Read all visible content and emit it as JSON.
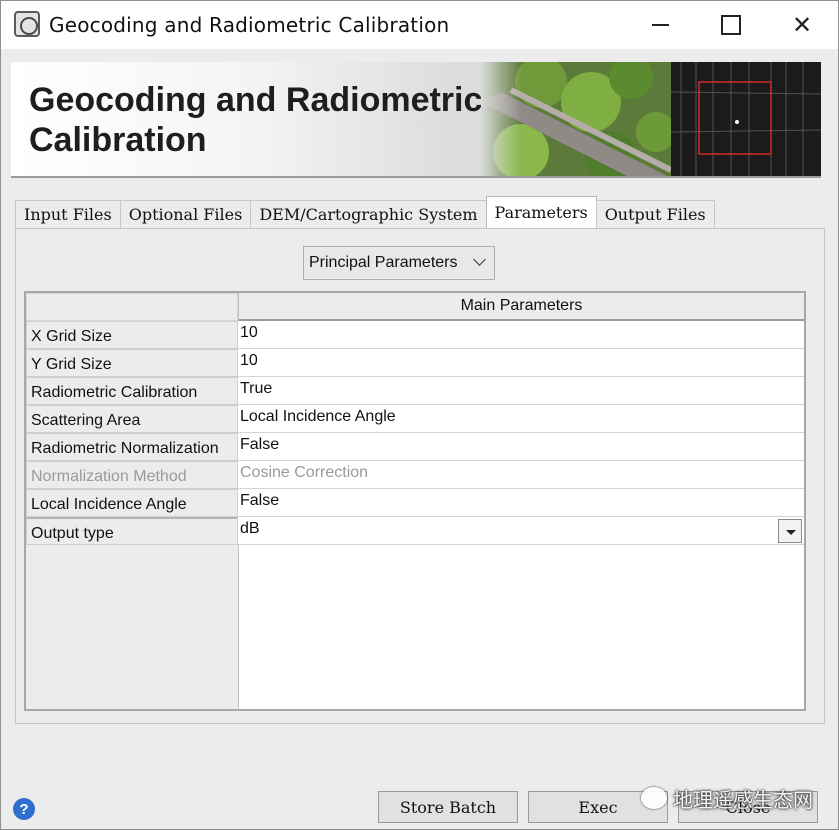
{
  "window": {
    "title": "Geocoding and Radiometric Calibration"
  },
  "banner": {
    "title_line1": "Geocoding and Radiometric",
    "title_line2": "Calibration"
  },
  "tabs": [
    {
      "label": "Input Files"
    },
    {
      "label": "Optional Files"
    },
    {
      "label": "DEM/Cartographic System"
    },
    {
      "label": "Parameters",
      "active": true
    },
    {
      "label": "Output Files"
    }
  ],
  "parameter_group": {
    "selected": "Principal Parameters"
  },
  "table": {
    "header": "Main Parameters",
    "rows": [
      {
        "name": "X Grid Size",
        "value": "10"
      },
      {
        "name": "Y Grid Size",
        "value": "10"
      },
      {
        "name": "Radiometric Calibration",
        "value": "True"
      },
      {
        "name": "Scattering Area",
        "value": "Local Incidence Angle"
      },
      {
        "name": "Radiometric Normalization",
        "value": "False"
      },
      {
        "name": "Normalization Method",
        "value": "Cosine Correction",
        "disabled": true
      },
      {
        "name": "Local Incidence Angle",
        "value": "False"
      },
      {
        "name": "Output type",
        "value": "dB"
      }
    ]
  },
  "buttons": {
    "store_batch": "Store Batch",
    "exec": "Exec",
    "close": "Close"
  },
  "watermark": {
    "text": "地理遥感生态网"
  },
  "colors": {
    "help_icon": "#2f6fd0",
    "disabled_text": "#9a9a9a"
  }
}
